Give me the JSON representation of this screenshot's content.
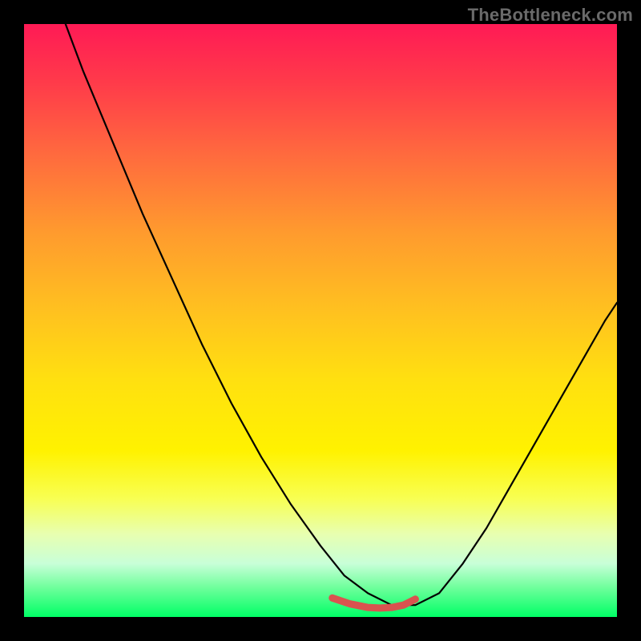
{
  "watermark": "TheBottleneck.com",
  "chart_data": {
    "type": "line",
    "title": "",
    "xlabel": "",
    "ylabel": "",
    "xlim": [
      0,
      100
    ],
    "ylim": [
      0,
      100
    ],
    "grid": false,
    "legend": false,
    "background": "gradient-red-yellow-green",
    "series": [
      {
        "name": "black-curve",
        "color": "#000000",
        "x": [
          7,
          10,
          15,
          20,
          25,
          30,
          35,
          40,
          45,
          50,
          54,
          58,
          62,
          66,
          70,
          74,
          78,
          82,
          86,
          90,
          94,
          98,
          100
        ],
        "values": [
          100,
          92,
          80,
          68,
          57,
          46,
          36,
          27,
          19,
          12,
          7,
          4,
          2,
          2,
          4,
          9,
          15,
          22,
          29,
          36,
          43,
          50,
          53
        ]
      },
      {
        "name": "red-segment",
        "color": "#d9534f",
        "x": [
          52,
          55,
          58,
          60,
          62,
          64,
          66
        ],
        "values": [
          3.2,
          2.2,
          1.6,
          1.5,
          1.6,
          2.0,
          3.0
        ]
      }
    ]
  }
}
